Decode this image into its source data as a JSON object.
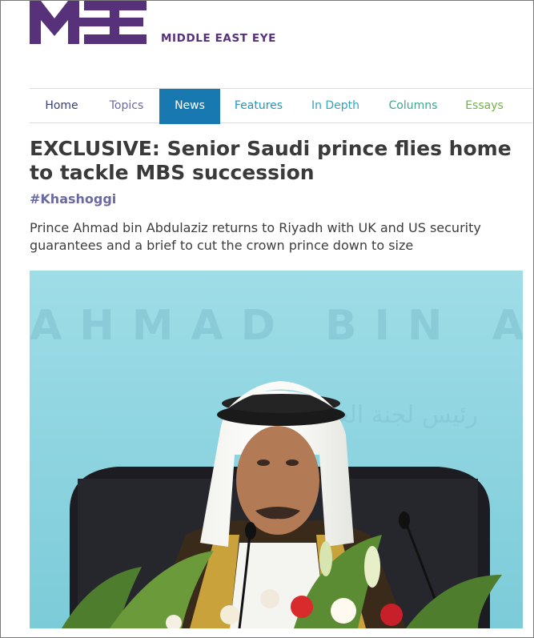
{
  "brand": {
    "name": "MIDDLE EAST EYE",
    "logo_mark": "MEE",
    "color": "#57317a"
  },
  "nav": {
    "items": [
      {
        "label": "Home",
        "color": "#3a3f6e"
      },
      {
        "label": "Topics",
        "color": "#6b6aa0"
      },
      {
        "label": "News",
        "color": "#ffffff",
        "active": true,
        "background": "#1878b0"
      },
      {
        "label": "Features",
        "color": "#2296b8"
      },
      {
        "label": "In Depth",
        "color": "#35a5b8"
      },
      {
        "label": "Columns",
        "color": "#3fa58e"
      },
      {
        "label": "Essays",
        "color": "#76b04c"
      }
    ]
  },
  "article": {
    "headline": "EXCLUSIVE: Senior Saudi prince flies home to tackle MBS succession",
    "tag": "#Khashoggi",
    "standfirst": "Prince Ahmad bin Abdulaziz returns to Riyadh with UK and US security guarantees and a brief to cut the crown prince down to size",
    "image": {
      "backdrop_text": "AHMAD BIN AB",
      "backdrop_text_arabic": "رئيس لجنة العليا"
    }
  }
}
